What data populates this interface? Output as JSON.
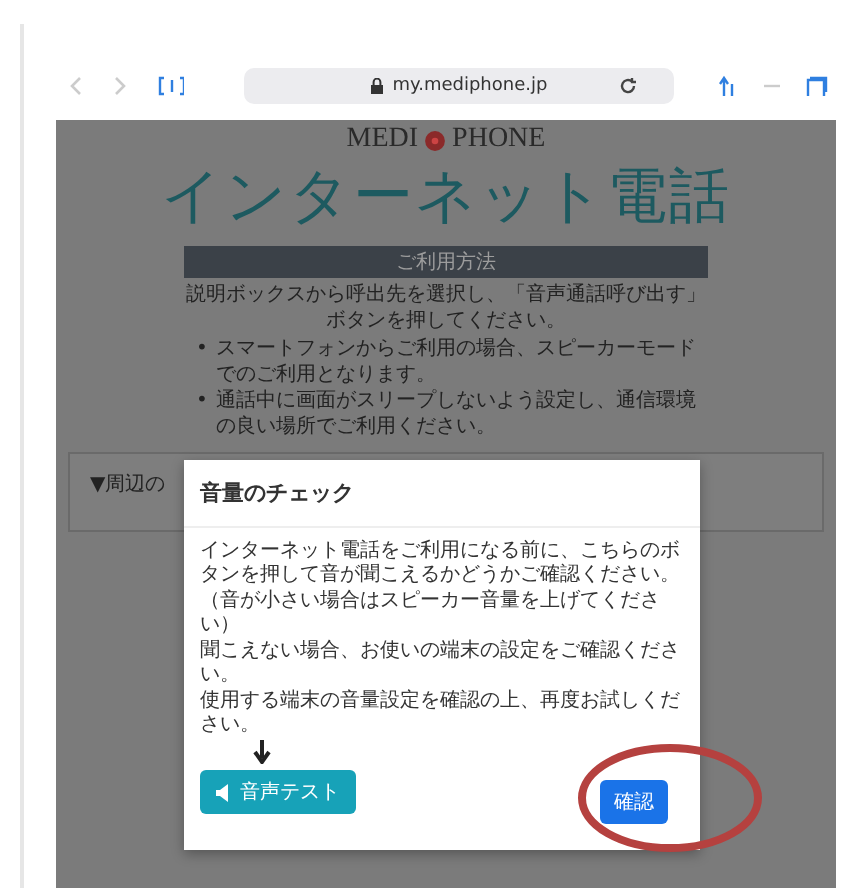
{
  "browser": {
    "url": "my.mediphone.jp"
  },
  "page": {
    "logo_left": "MEDI",
    "logo_right": "PHONE",
    "title": "インターネット電話",
    "guide": {
      "heading": "ご利用方法",
      "text": "説明ボックスから呼出先を選択し、「音声通話呼び出す」ボタンを押してください。",
      "bullets": [
        {
          "marker": "•",
          "text": "スマートフォンからご利用の場合、スピーカーモードでのご利用となります。"
        },
        {
          "marker": "•",
          "text": "通話中に画面がスリープしないよう設定し、通信環境の良い場所でご利用ください。"
        }
      ]
    },
    "collapsed_section": {
      "label": "▼周辺の"
    }
  },
  "modal": {
    "title": "音量のチェック",
    "lines": [
      "インターネット電話をご利用になる前に、こちらのボタンを押して音が聞こえるかどうかご確認ください。",
      "（音が小さい場合はスピーカー音量を上げてください）",
      "聞こえない場合、お使いの端末の設定をご確認ください。",
      "使用する端末の音量設定を確認の上、再度お試しください。"
    ],
    "test_button": "音声テスト",
    "confirm_button": "確認"
  },
  "annotation": {
    "kind": "circle",
    "color": "#b5413f"
  }
}
